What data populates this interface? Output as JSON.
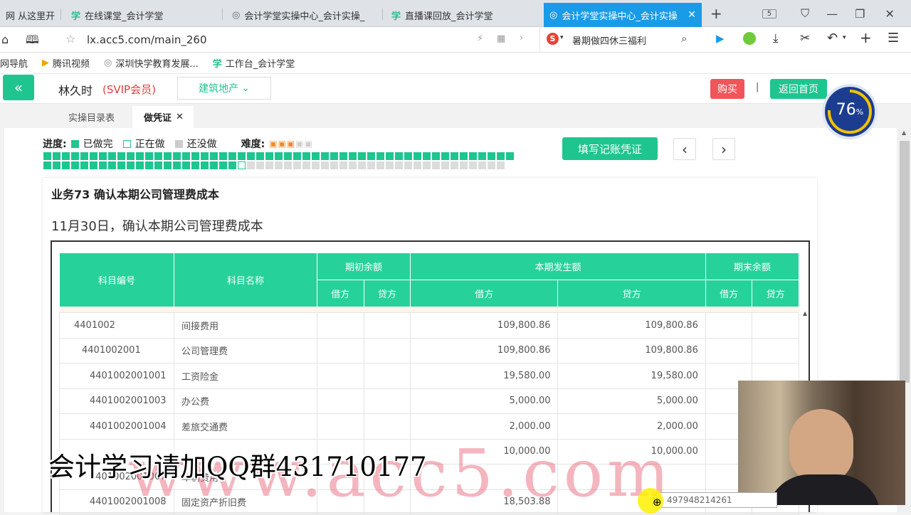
{
  "browser": {
    "tabs": [
      {
        "label": "网 从这里开",
        "icon": ""
      },
      {
        "label": "在线课堂_会计学堂",
        "icon": "学"
      },
      {
        "label": "会计学堂实操中心_会计实操_",
        "icon": "◎"
      },
      {
        "label": "直播课回放_会计学堂",
        "icon": "学"
      },
      {
        "label": "会计学堂实操中心_会计实操",
        "icon": "◎"
      }
    ],
    "tab_count": "5",
    "url": "lx.acc5.com/main_260",
    "search_hint": "暑期做四休三福利",
    "bookmarks": [
      "网导航",
      "腾讯视频",
      "深圳快学教育发展...",
      "工作台_会计学堂"
    ]
  },
  "header": {
    "user_name": "林久时",
    "member_badge": "(SVIP会员)",
    "industry": "建筑地产",
    "buy_label": "购买",
    "divider": "|",
    "home_label": "返回首页",
    "score": "76",
    "score_unit": "%"
  },
  "subtabs": {
    "catalog": "实操目录表",
    "voucher": "做凭证"
  },
  "progress": {
    "label": "进度:",
    "done": "已做完",
    "doing": "正在做",
    "todo": "还没做",
    "difficulty_label": "难度:",
    "difficulty_stars": 3,
    "difficulty_max": 5,
    "done_count": 73,
    "total_count": 101
  },
  "actions": {
    "fill_voucher": "填写记账凭证",
    "prev": "‹",
    "next": "›"
  },
  "task": {
    "title": "业务73 确认本期公司管理费成本",
    "desc": "11月30日，确认本期公司管理费成本"
  },
  "table": {
    "headers": {
      "code": "科目编号",
      "name": "科目名称",
      "opening": "期初余额",
      "current": "本期发生额",
      "closing": "期末余额",
      "debit": "借方",
      "credit": "贷方"
    },
    "rows": [
      {
        "code": "4401002",
        "name": "间接费用",
        "indent": 0,
        "d": "109,800.86",
        "c": "109,800.86"
      },
      {
        "code": "4401002001",
        "name": "公司管理费",
        "indent": 1,
        "d": "109,800.86",
        "c": "109,800.86"
      },
      {
        "code": "4401002001001",
        "name": "工资险金",
        "indent": 2,
        "d": "19,580.00",
        "c": "19,580.00"
      },
      {
        "code": "4401002001003",
        "name": "办公费",
        "indent": 2,
        "d": "5,000.00",
        "c": "5,000.00"
      },
      {
        "code": "4401002001004",
        "name": "差旅交通费",
        "indent": 2,
        "d": "2,000.00",
        "c": "2,000.00"
      },
      {
        "code": "",
        "name": "",
        "indent": 2,
        "d": "10,000.00",
        "c": "10,000.00"
      },
      {
        "code": "4401002001007",
        "name": "车辆费用",
        "indent": 2,
        "d": "",
        "c": ""
      },
      {
        "code": "4401002001008",
        "name": "固定资产折旧费",
        "indent": 2,
        "d": "18,503.88",
        "c": "18,503.88"
      }
    ]
  },
  "overlay": {
    "watermark_text": "会计学习请加QQ群431710177",
    "watermark_logo": "www.acc5.com",
    "qq_number": "497948214261"
  },
  "colors": {
    "accent": "#27d19a",
    "tab_active": "#1a9be8",
    "buy": "#f0555a",
    "badge": "#e33c3c"
  }
}
